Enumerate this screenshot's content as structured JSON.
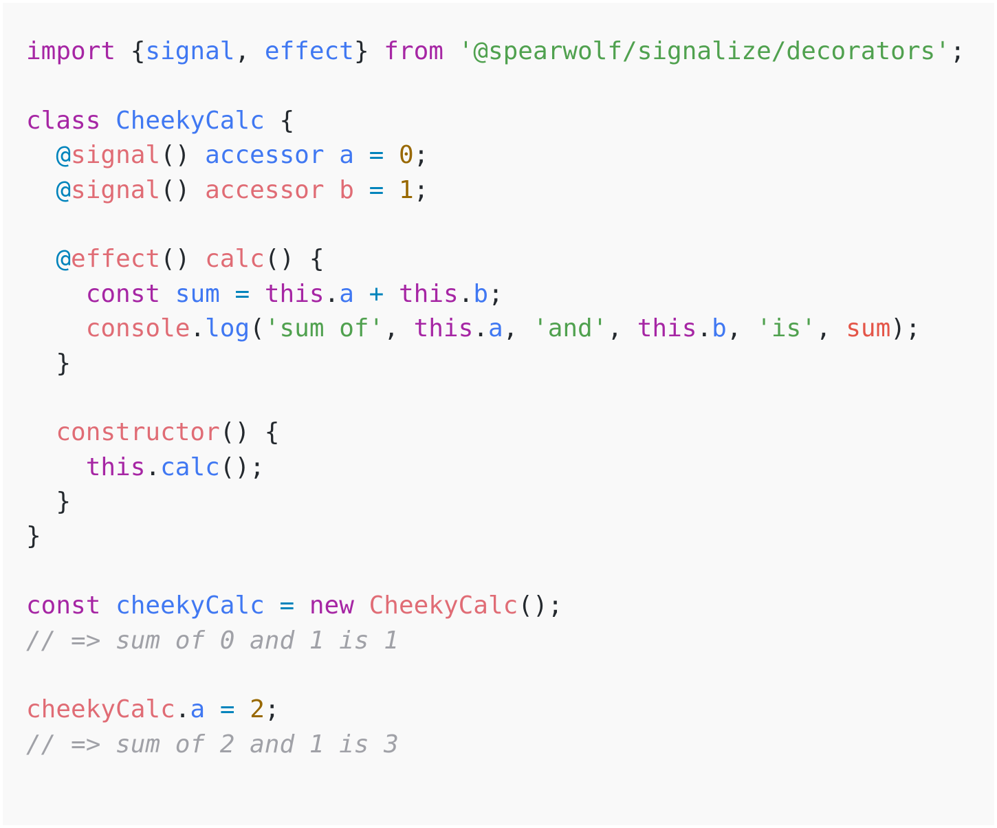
{
  "colors": {
    "background": "#f9f9f9",
    "plain": "#24292e",
    "keyword": "#a626a4",
    "identifier": "#4078f2",
    "string": "#50a14f",
    "number": "#986801",
    "property": "#e06c75",
    "decorator": "#0184bc",
    "comment": "#a0a1a7",
    "operator": "#0184bc",
    "variable": "#e45649"
  },
  "code_block": {
    "language": "javascript",
    "lines": [
      [
        [
          "keyword",
          "import"
        ],
        [
          "plain",
          " {"
        ],
        [
          "identifier",
          "signal"
        ],
        [
          "plain",
          ", "
        ],
        [
          "identifier",
          "effect"
        ],
        [
          "plain",
          "} "
        ],
        [
          "keyword",
          "from"
        ],
        [
          "plain",
          " "
        ],
        [
          "string",
          "'@spearwolf/signalize/decorators'"
        ],
        [
          "plain",
          ";"
        ]
      ],
      [],
      [
        [
          "keyword",
          "class"
        ],
        [
          "plain",
          " "
        ],
        [
          "identifier",
          "CheekyCalc"
        ],
        [
          "plain",
          " {"
        ]
      ],
      [
        [
          "plain",
          "  "
        ],
        [
          "decorator",
          "@"
        ],
        [
          "property",
          "signal"
        ],
        [
          "plain",
          "() "
        ],
        [
          "identifier",
          "accessor"
        ],
        [
          "plain",
          " "
        ],
        [
          "identifier",
          "a"
        ],
        [
          "plain",
          " "
        ],
        [
          "operator",
          "="
        ],
        [
          "plain",
          " "
        ],
        [
          "number",
          "0"
        ],
        [
          "plain",
          ";"
        ]
      ],
      [
        [
          "plain",
          "  "
        ],
        [
          "decorator",
          "@"
        ],
        [
          "property",
          "signal"
        ],
        [
          "plain",
          "() "
        ],
        [
          "property",
          "accessor"
        ],
        [
          "plain",
          " "
        ],
        [
          "property",
          "b"
        ],
        [
          "plain",
          " "
        ],
        [
          "operator",
          "="
        ],
        [
          "plain",
          " "
        ],
        [
          "number",
          "1"
        ],
        [
          "plain",
          ";"
        ]
      ],
      [],
      [
        [
          "plain",
          "  "
        ],
        [
          "decorator",
          "@"
        ],
        [
          "property",
          "effect"
        ],
        [
          "plain",
          "() "
        ],
        [
          "property",
          "calc"
        ],
        [
          "plain",
          "() {"
        ]
      ],
      [
        [
          "plain",
          "    "
        ],
        [
          "keyword",
          "const"
        ],
        [
          "plain",
          " "
        ],
        [
          "identifier",
          "sum"
        ],
        [
          "plain",
          " "
        ],
        [
          "operator",
          "="
        ],
        [
          "plain",
          " "
        ],
        [
          "keyword",
          "this"
        ],
        [
          "plain",
          "."
        ],
        [
          "identifier",
          "a"
        ],
        [
          "plain",
          " "
        ],
        [
          "operator",
          "+"
        ],
        [
          "plain",
          " "
        ],
        [
          "keyword",
          "this"
        ],
        [
          "plain",
          "."
        ],
        [
          "identifier",
          "b"
        ],
        [
          "plain",
          ";"
        ]
      ],
      [
        [
          "plain",
          "    "
        ],
        [
          "property",
          "console"
        ],
        [
          "plain",
          "."
        ],
        [
          "identifier",
          "log"
        ],
        [
          "plain",
          "("
        ],
        [
          "string",
          "'sum of'"
        ],
        [
          "plain",
          ", "
        ],
        [
          "keyword",
          "this"
        ],
        [
          "plain",
          "."
        ],
        [
          "identifier",
          "a"
        ],
        [
          "plain",
          ", "
        ],
        [
          "string",
          "'and'"
        ],
        [
          "plain",
          ", "
        ],
        [
          "keyword",
          "this"
        ],
        [
          "plain",
          "."
        ],
        [
          "identifier",
          "b"
        ],
        [
          "plain",
          ", "
        ],
        [
          "string",
          "'is'"
        ],
        [
          "plain",
          ", "
        ],
        [
          "variable",
          "sum"
        ],
        [
          "plain",
          ");"
        ]
      ],
      [
        [
          "plain",
          "  }"
        ]
      ],
      [],
      [
        [
          "plain",
          "  "
        ],
        [
          "property",
          "constructor"
        ],
        [
          "plain",
          "() {"
        ]
      ],
      [
        [
          "plain",
          "    "
        ],
        [
          "keyword",
          "this"
        ],
        [
          "plain",
          "."
        ],
        [
          "identifier",
          "calc"
        ],
        [
          "plain",
          "();"
        ]
      ],
      [
        [
          "plain",
          "  }"
        ]
      ],
      [
        [
          "plain",
          "}"
        ]
      ],
      [],
      [
        [
          "keyword",
          "const"
        ],
        [
          "plain",
          " "
        ],
        [
          "identifier",
          "cheekyCalc"
        ],
        [
          "plain",
          " "
        ],
        [
          "operator",
          "="
        ],
        [
          "plain",
          " "
        ],
        [
          "keyword",
          "new"
        ],
        [
          "plain",
          " "
        ],
        [
          "property",
          "CheekyCalc"
        ],
        [
          "plain",
          "();"
        ]
      ],
      [
        [
          "comment",
          "// => sum of 0 and 1 is 1"
        ]
      ],
      [],
      [
        [
          "property",
          "cheekyCalc"
        ],
        [
          "plain",
          "."
        ],
        [
          "identifier",
          "a"
        ],
        [
          "plain",
          " "
        ],
        [
          "operator",
          "="
        ],
        [
          "plain",
          " "
        ],
        [
          "number",
          "2"
        ],
        [
          "plain",
          ";"
        ]
      ],
      [
        [
          "comment",
          "// => sum of 2 and 1 is 3"
        ]
      ]
    ]
  }
}
